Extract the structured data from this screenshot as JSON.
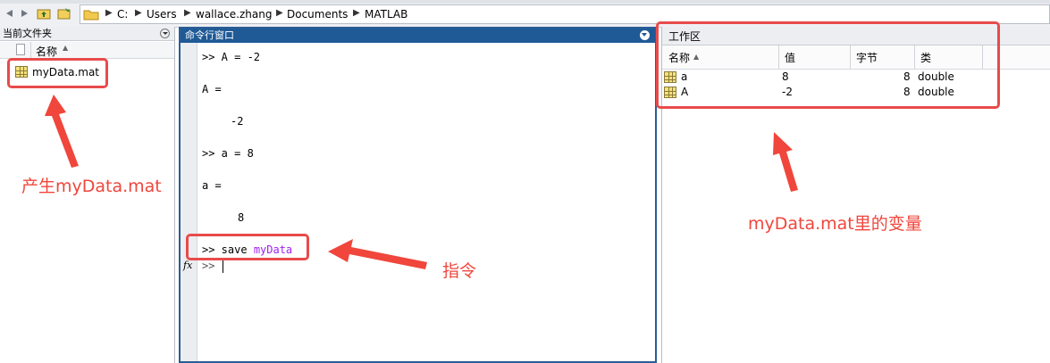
{
  "breadcrumb": [
    "C:",
    "Users",
    "wallace.zhang",
    "Documents",
    "MATLAB"
  ],
  "panels": {
    "files_title": "当前文件夹",
    "files_col_name": "名称",
    "cmd_title": "命令行窗口",
    "ws_title": "工作区"
  },
  "files": [
    "myData.mat"
  ],
  "command_window": {
    "lines": [
      ">> A = -2",
      "A =",
      "-2",
      ">> a = 8",
      "a =",
      "8"
    ],
    "save_prompt": ">> save",
    "save_arg": "myData",
    "fx": "fx",
    "prompt": ">>"
  },
  "workspace": {
    "columns": [
      "名称",
      "值",
      "字节",
      "类"
    ],
    "rows": [
      {
        "name": "a",
        "value": "8",
        "bytes": "8",
        "class": "double"
      },
      {
        "name": "A",
        "value": "-2",
        "bytes": "8",
        "class": "double"
      }
    ]
  },
  "annotations": {
    "file_note": "产生myData.mat",
    "cmd_note": "指令",
    "ws_note": "myData.mat里的变量"
  },
  "colors": {
    "annotation": "#e84b4b",
    "accent": "#1f5a96"
  }
}
